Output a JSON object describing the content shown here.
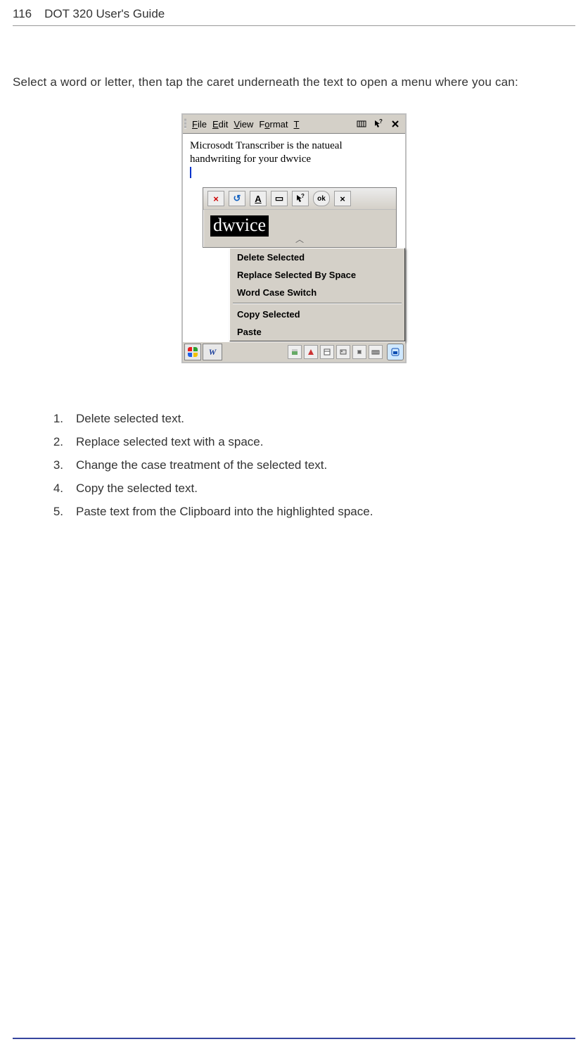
{
  "header": {
    "page_number": "116",
    "doc_title": "DOT 320 User's Guide"
  },
  "body": {
    "intro": "Select a word or letter, then tap the caret underneath the text to open a menu where you can:"
  },
  "screenshot": {
    "menubar": {
      "items": [
        "File",
        "Edit",
        "View",
        "Format",
        "T"
      ],
      "icon_right_1": "input-panel-icon",
      "icon_right_2": "help-pointer-icon",
      "icon_close": "close-icon"
    },
    "document_text_line1": "Microsodt Transcriber is the natueal",
    "document_text_line2": "handwriting for your dwvice",
    "popup_toolbar": {
      "btn_close": "×",
      "btn_undo": "↺",
      "btn_font": "A",
      "btn_rect": "▭",
      "btn_help": "?",
      "btn_ok": "ok",
      "btn_x": "×"
    },
    "selected_word": "dwvice",
    "context_menu": {
      "items": [
        "Delete Selected",
        "Replace Selected By Space",
        "Word Case Switch",
        "Copy Selected",
        "Paste"
      ]
    },
    "taskbar": {
      "app_label": "W"
    }
  },
  "list": {
    "items": [
      "Delete selected text.",
      "Replace selected text with a space.",
      "Change the case treatment of the selected text.",
      "Copy the selected text.",
      "Paste text from the Clipboard into the highlighted space."
    ]
  }
}
